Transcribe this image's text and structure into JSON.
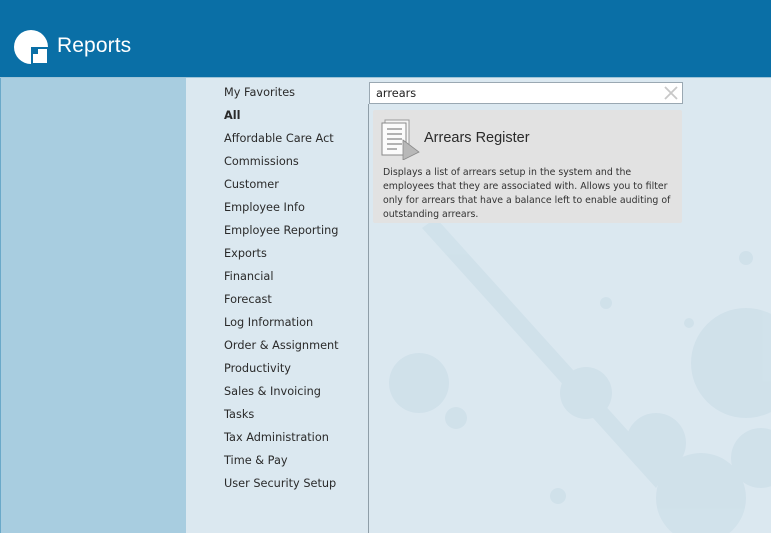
{
  "header": {
    "app_title": "Reports",
    "background": "#0a6fa6"
  },
  "sidebar": {
    "categories": [
      {
        "label": "My Favorites",
        "active": false
      },
      {
        "label": "All",
        "active": true
      },
      {
        "label": "Affordable Care Act",
        "active": false
      },
      {
        "label": "Commissions",
        "active": false
      },
      {
        "label": "Customer",
        "active": false
      },
      {
        "label": "Employee Info",
        "active": false
      },
      {
        "label": "Employee Reporting",
        "active": false
      },
      {
        "label": "Exports",
        "active": false
      },
      {
        "label": "Financial",
        "active": false
      },
      {
        "label": "Forecast",
        "active": false
      },
      {
        "label": "Log Information",
        "active": false
      },
      {
        "label": "Order & Assignment",
        "active": false
      },
      {
        "label": "Productivity",
        "active": false
      },
      {
        "label": "Sales & Invoicing",
        "active": false
      },
      {
        "label": "Tasks",
        "active": false
      },
      {
        "label": "Tax Administration",
        "active": false
      },
      {
        "label": "Time & Pay",
        "active": false
      },
      {
        "label": "User Security Setup",
        "active": false
      }
    ]
  },
  "search": {
    "value": "arrears",
    "clear_icon": "close-icon"
  },
  "results": [
    {
      "title": "Arrears Register",
      "icon": "report-document-icon",
      "description": "Displays a list of arrears setup in the system and the employees that they are associated with.  Allows you to filter only for arrears that have a balance left to enable auditing of outstanding arrears."
    }
  ]
}
